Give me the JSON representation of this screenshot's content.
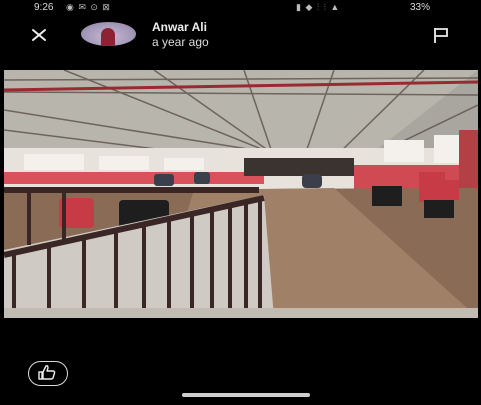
{
  "status_bar": {
    "time": "9:26",
    "left_icons": "◉ ✉ ⊙ ⊠",
    "right_icons": "▮ ◆ ⫶ ⫶ ▲",
    "battery": "33%"
  },
  "header": {
    "user_name": "Anwar Ali",
    "post_time": "a year ago"
  },
  "icons": {
    "close": "close-icon",
    "flag": "flag-icon",
    "like": "thumbs-up-icon"
  },
  "colors": {
    "background": "#000000",
    "accent_red": "#c0343f"
  }
}
